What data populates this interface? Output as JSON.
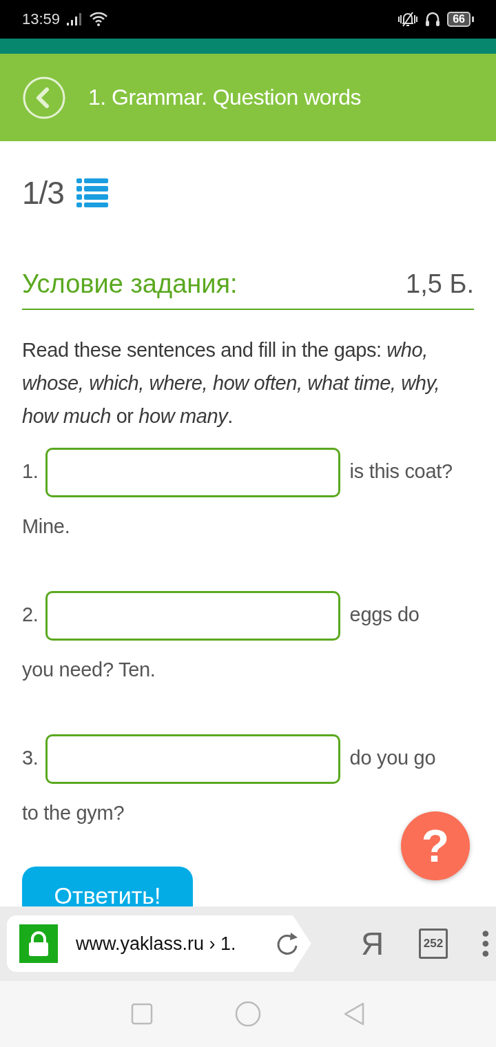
{
  "status_bar": {
    "time": "13:59",
    "battery": "66"
  },
  "header": {
    "title": "1. Grammar. Question words"
  },
  "task": {
    "progress": "1/3",
    "heading": "Условие задания:",
    "points": "1,5 Б.",
    "instruction": "Read these sentences and fill in the gaps: *who, whose, which, where, how often, what time, why, how much* or *how many*.",
    "questions": [
      {
        "number": "1.",
        "text": "is this coat?",
        "next_line": "Mine."
      },
      {
        "number": "2.",
        "text": "eggs do",
        "next_line": "you need? Ten."
      },
      {
        "number": "3.",
        "text": "do you go",
        "next_line": "to the gym?"
      }
    ],
    "submit_button": "Ответить!",
    "help_button": "?"
  },
  "browser_bar": {
    "url": "www.yaklass.ru › 1.",
    "search_label": "Я",
    "tab_count": "252"
  }
}
